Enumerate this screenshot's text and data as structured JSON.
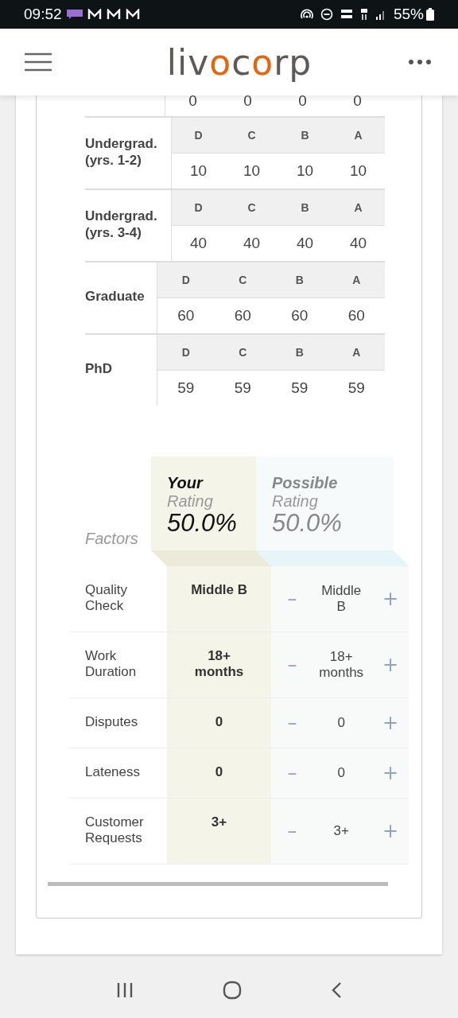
{
  "status_bar": {
    "time": "09:52",
    "battery": "55%"
  },
  "header": {
    "logo": [
      {
        "text": "liv",
        "accent": false
      },
      {
        "text": "o",
        "accent": true
      },
      {
        "text": "c",
        "accent": false
      },
      {
        "text": "o",
        "accent": true
      },
      {
        "text": "rp",
        "accent": false
      }
    ]
  },
  "grade_table": {
    "partial_row": {
      "values": [
        "0",
        "0",
        "0",
        "0"
      ]
    },
    "groups": [
      {
        "label": "Undergrad. (yrs. 1-2)",
        "grades": [
          "D",
          "C",
          "B",
          "A"
        ],
        "values": [
          "10",
          "10",
          "10",
          "10"
        ]
      },
      {
        "label": "Undergrad. (yrs. 3-4)",
        "grades": [
          "D",
          "C",
          "B",
          "A"
        ],
        "values": [
          "40",
          "40",
          "40",
          "40"
        ]
      },
      {
        "label": "Graduate",
        "grades": [
          "D",
          "C",
          "B",
          "A"
        ],
        "values": [
          "60",
          "60",
          "60",
          "60"
        ]
      },
      {
        "label": "PhD",
        "grades": [
          "D",
          "C",
          "B",
          "A"
        ],
        "values": [
          "59",
          "59",
          "59",
          "59"
        ]
      }
    ]
  },
  "factors": {
    "label": "Factors",
    "your_rating": {
      "title": "Your",
      "subtitle": "Rating",
      "value": "50.0%"
    },
    "possible_rating": {
      "title": "Possible",
      "subtitle": "Rating",
      "value": "50.0%"
    },
    "rows": [
      {
        "name": "Quality Check",
        "your": "Middle B",
        "possible": "Middle B",
        "minus": "–",
        "plus": "+"
      },
      {
        "name": "Work Duration",
        "your": "18+ months",
        "possible": "18+ months",
        "minus": "–",
        "plus": "+"
      },
      {
        "name": "Disputes",
        "your": "0",
        "possible": "0",
        "minus": "–",
        "plus": "+"
      },
      {
        "name": "Lateness",
        "your": "0",
        "possible": "0",
        "minus": "–",
        "plus": "+"
      },
      {
        "name": "Customer Requests",
        "your": "3+",
        "possible": "3+",
        "minus": "–",
        "plus": "+"
      }
    ]
  }
}
